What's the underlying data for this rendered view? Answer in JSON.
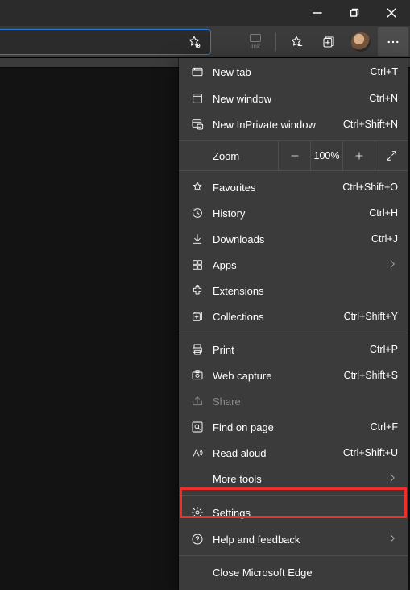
{
  "toolbar": {
    "link_label": "link"
  },
  "menu": {
    "new_tab": {
      "label": "New tab",
      "shortcut": "Ctrl+T"
    },
    "new_window": {
      "label": "New window",
      "shortcut": "Ctrl+N"
    },
    "new_inprivate": {
      "label": "New InPrivate window",
      "shortcut": "Ctrl+Shift+N"
    },
    "zoom": {
      "label": "Zoom",
      "value": "100%"
    },
    "favorites": {
      "label": "Favorites",
      "shortcut": "Ctrl+Shift+O"
    },
    "history": {
      "label": "History",
      "shortcut": "Ctrl+H"
    },
    "downloads": {
      "label": "Downloads",
      "shortcut": "Ctrl+J"
    },
    "apps": {
      "label": "Apps"
    },
    "extensions": {
      "label": "Extensions"
    },
    "collections": {
      "label": "Collections",
      "shortcut": "Ctrl+Shift+Y"
    },
    "print": {
      "label": "Print",
      "shortcut": "Ctrl+P"
    },
    "web_capture": {
      "label": "Web capture",
      "shortcut": "Ctrl+Shift+S"
    },
    "share": {
      "label": "Share"
    },
    "find": {
      "label": "Find on page",
      "shortcut": "Ctrl+F"
    },
    "read_aloud": {
      "label": "Read aloud",
      "shortcut": "Ctrl+Shift+U"
    },
    "more_tools": {
      "label": "More tools"
    },
    "settings": {
      "label": "Settings"
    },
    "help": {
      "label": "Help and feedback"
    },
    "close": {
      "label": "Close Microsoft Edge"
    }
  },
  "highlighted_item": "settings"
}
